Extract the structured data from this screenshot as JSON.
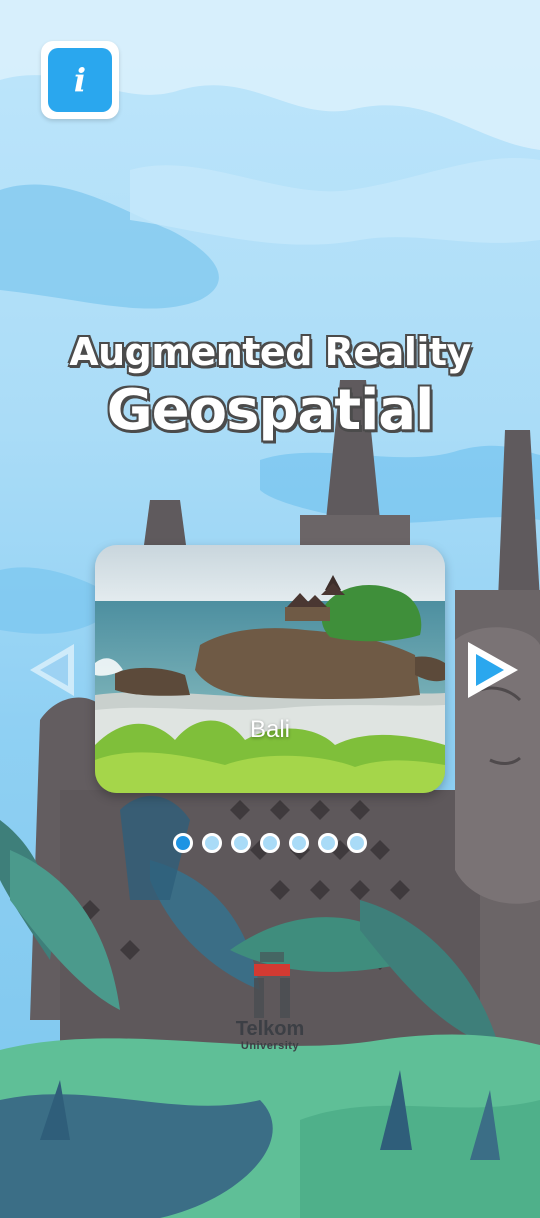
{
  "info_button": {
    "icon": "info-icon",
    "label": "i"
  },
  "title": {
    "line1": "Augmented Reality",
    "line2": "Geospatial"
  },
  "carousel": {
    "current_label": "Bali",
    "total_slides": 7,
    "active_index": 0,
    "prev_icon": "chevron-left-icon",
    "next_icon": "chevron-right-icon"
  },
  "logo": {
    "name": "Telkom",
    "sub": "University"
  },
  "colors": {
    "accent": "#1e94e3",
    "sky": "#aadcf7",
    "stone": "#5f5a5d",
    "foliage": "#5fbf97"
  }
}
